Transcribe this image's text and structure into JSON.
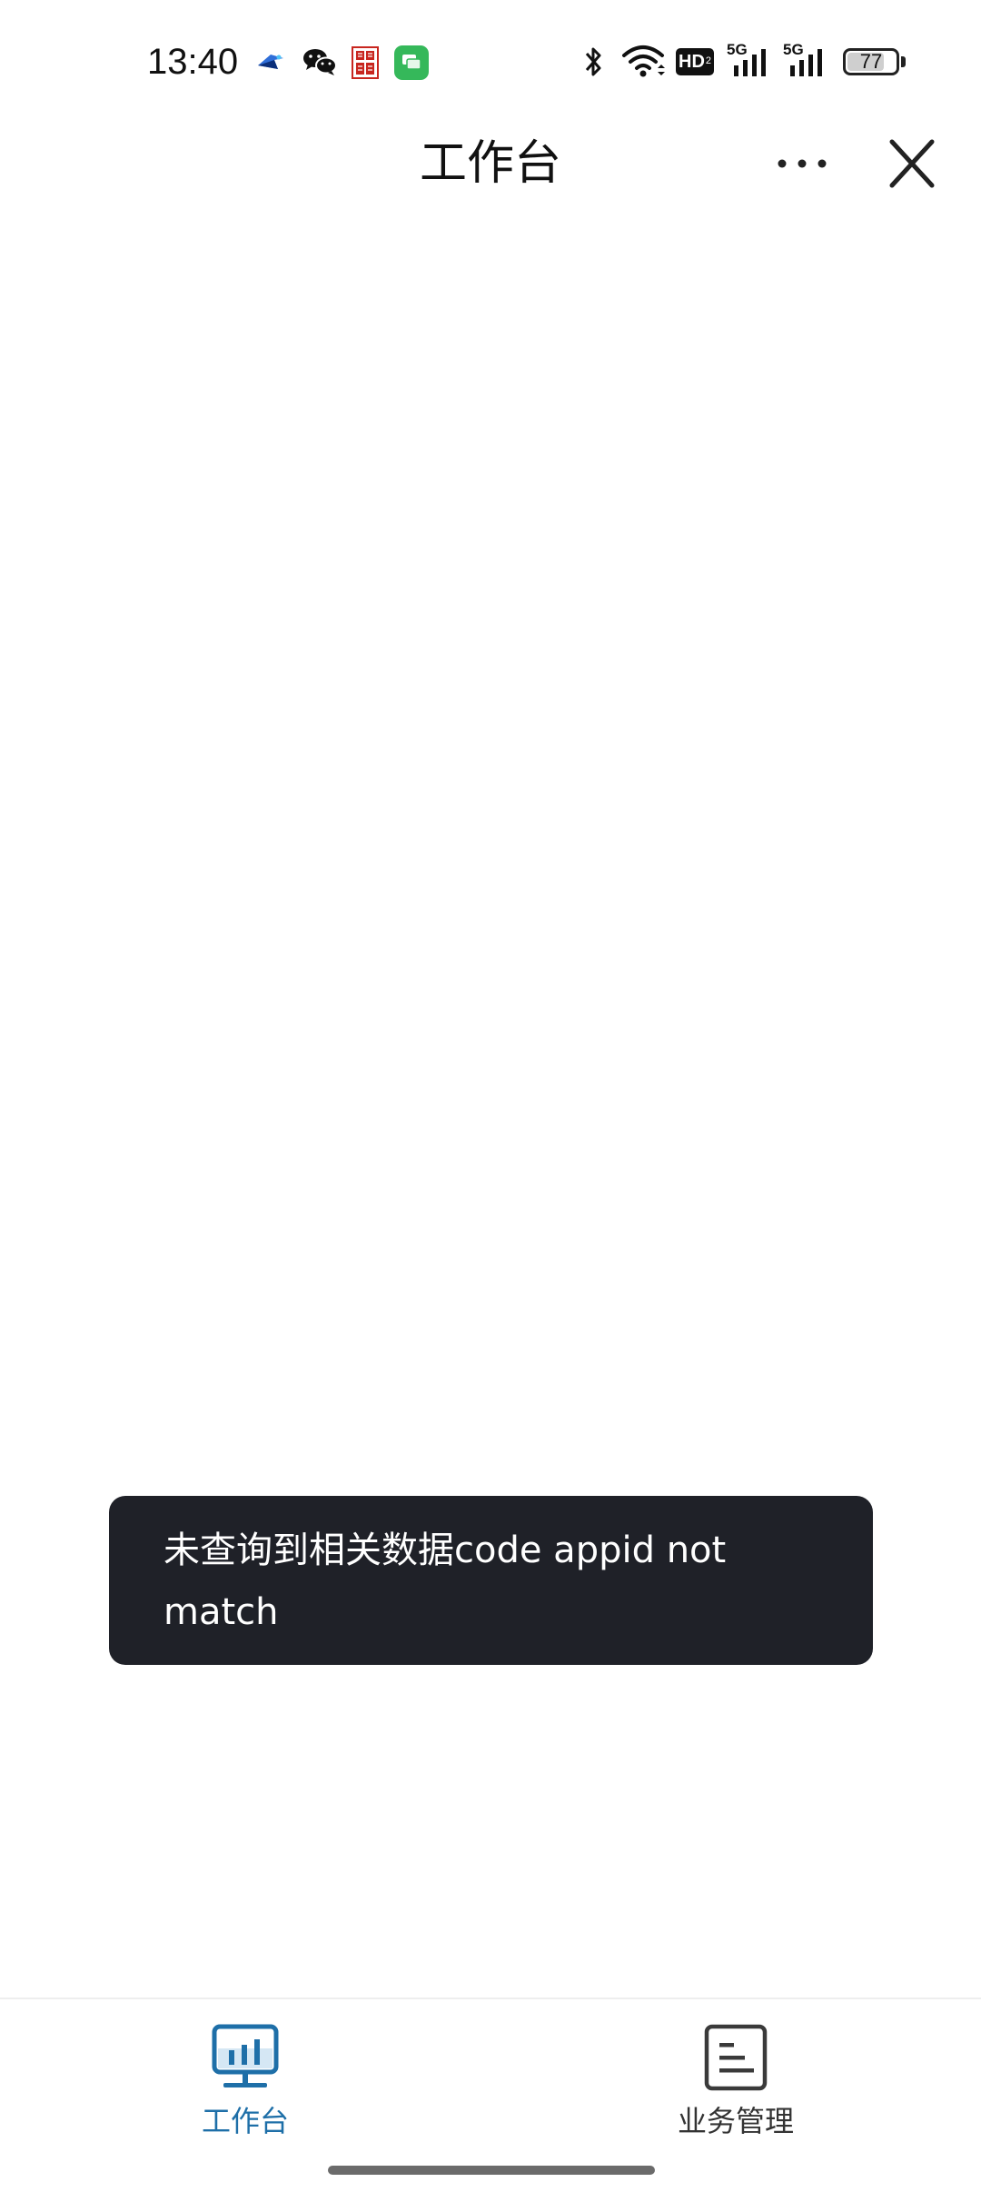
{
  "status_bar": {
    "time": "13:40",
    "notification_icons": [
      "bird-app-icon",
      "wechat-icon",
      "red-seal-app-icon",
      "messages-icon"
    ],
    "right_icons": [
      "bluetooth-icon",
      "wifi-icon",
      "hd-voice-icon",
      "signal-5g-icon",
      "signal-5g-icon"
    ],
    "hd_label": "HD",
    "network_label_1": "5G",
    "network_label_2": "5G",
    "battery_level": 77,
    "battery_text": "77"
  },
  "header": {
    "title": "工作台",
    "more_icon": "more-dots-icon",
    "close_icon": "close-icon"
  },
  "toast": {
    "message": "未查询到相关数据code appid not match"
  },
  "tab_bar": {
    "tabs": [
      {
        "label": "工作台",
        "icon": "workbench-chart-icon",
        "active": true
      },
      {
        "label": "业务管理",
        "icon": "document-list-icon",
        "active": false
      }
    ]
  },
  "colors": {
    "accent": "#1e6fa8",
    "toast_background": "#1f2128",
    "page_background": "#ffffff"
  }
}
